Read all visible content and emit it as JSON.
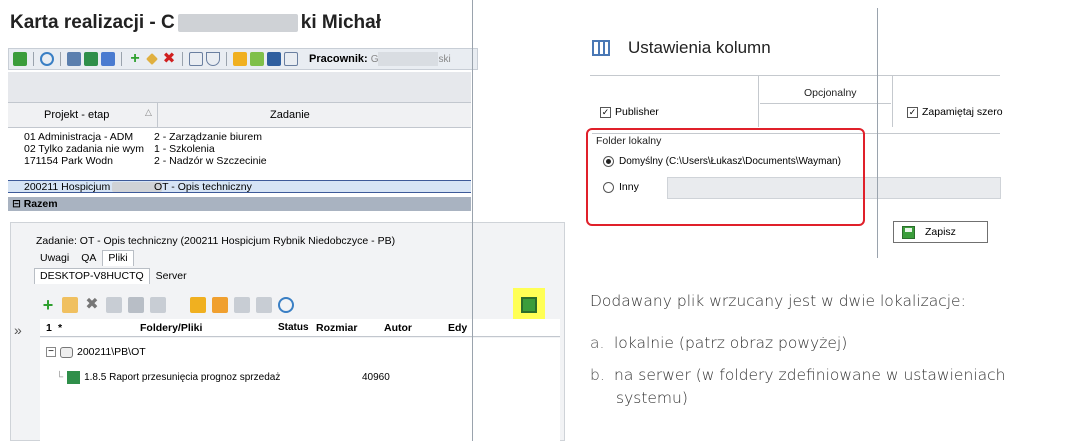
{
  "left_window": {
    "title_prefix": "Karta realizacji - C",
    "title_suffix": "ki Michał",
    "pracownik_label": "Pracownik:",
    "pracownik_value_prefix": "G",
    "pracownik_value_suffix": "ski",
    "grid": {
      "headers": [
        "Projekt - etap",
        "Zadanie"
      ],
      "rows": [
        {
          "project": "01 Administracja - ADM",
          "task": "2 - Zarządzanie biurem"
        },
        {
          "project": "02 Tylko zadania nie wym",
          "task": "1 - Szkolenia"
        },
        {
          "project": "171154 Park Wodn",
          "task": "2 - Nadzór w Szczecinie"
        },
        {
          "project": "200211 Hospicjum",
          "task": "OT - Opis techniczny"
        }
      ],
      "total_label": "Razem"
    },
    "task_line": "Zadanie: OT - Opis techniczny (200211 Hospicjum Rybnik Niedobczyce - PB)",
    "tabs": [
      "Uwagi",
      "QA",
      "Pliki"
    ],
    "subtabs": [
      "DESKTOP-V8HUCTQ",
      "Server"
    ],
    "files_header": {
      "num": "1",
      "star": "*",
      "col_folders": "Foldery/Pliki",
      "col_status": "Status",
      "col_size": "Rozmiar",
      "col_author": "Autor",
      "col_edit": "Edy"
    },
    "folder": "200211\\PB\\OT",
    "file": {
      "name": "1.8.5 Raport przesunięcia prognoz sprzedaż",
      "size": "40960"
    }
  },
  "dialog": {
    "title": "Ustawienia kolumn",
    "optional_label": "Opcjonalny",
    "publisher_label": "Publisher",
    "remember_label": "Zapamiętaj szero",
    "local_folder_group": "Folder lokalny",
    "default_option": "Domyślny (C:\\Users\\Łukasz\\Documents\\Wayman)",
    "other_option": "Inny",
    "save_button": "Zapisz"
  },
  "text": {
    "intro": "Dodawany plik wrzucany jest w dwie lokalizacje:",
    "items": [
      {
        "marker": "a.",
        "text": "lokalnie (patrz obraz powyżej)"
      },
      {
        "marker": "b.",
        "text": "na serwer (w foldery zdefiniowane w ustawieniach",
        "text_cont": "systemu)"
      }
    ]
  },
  "colors": {
    "highlight_yellow": "#ffff55",
    "callout_red": "#e0202a",
    "selection_blue": "#d6e4f5"
  }
}
